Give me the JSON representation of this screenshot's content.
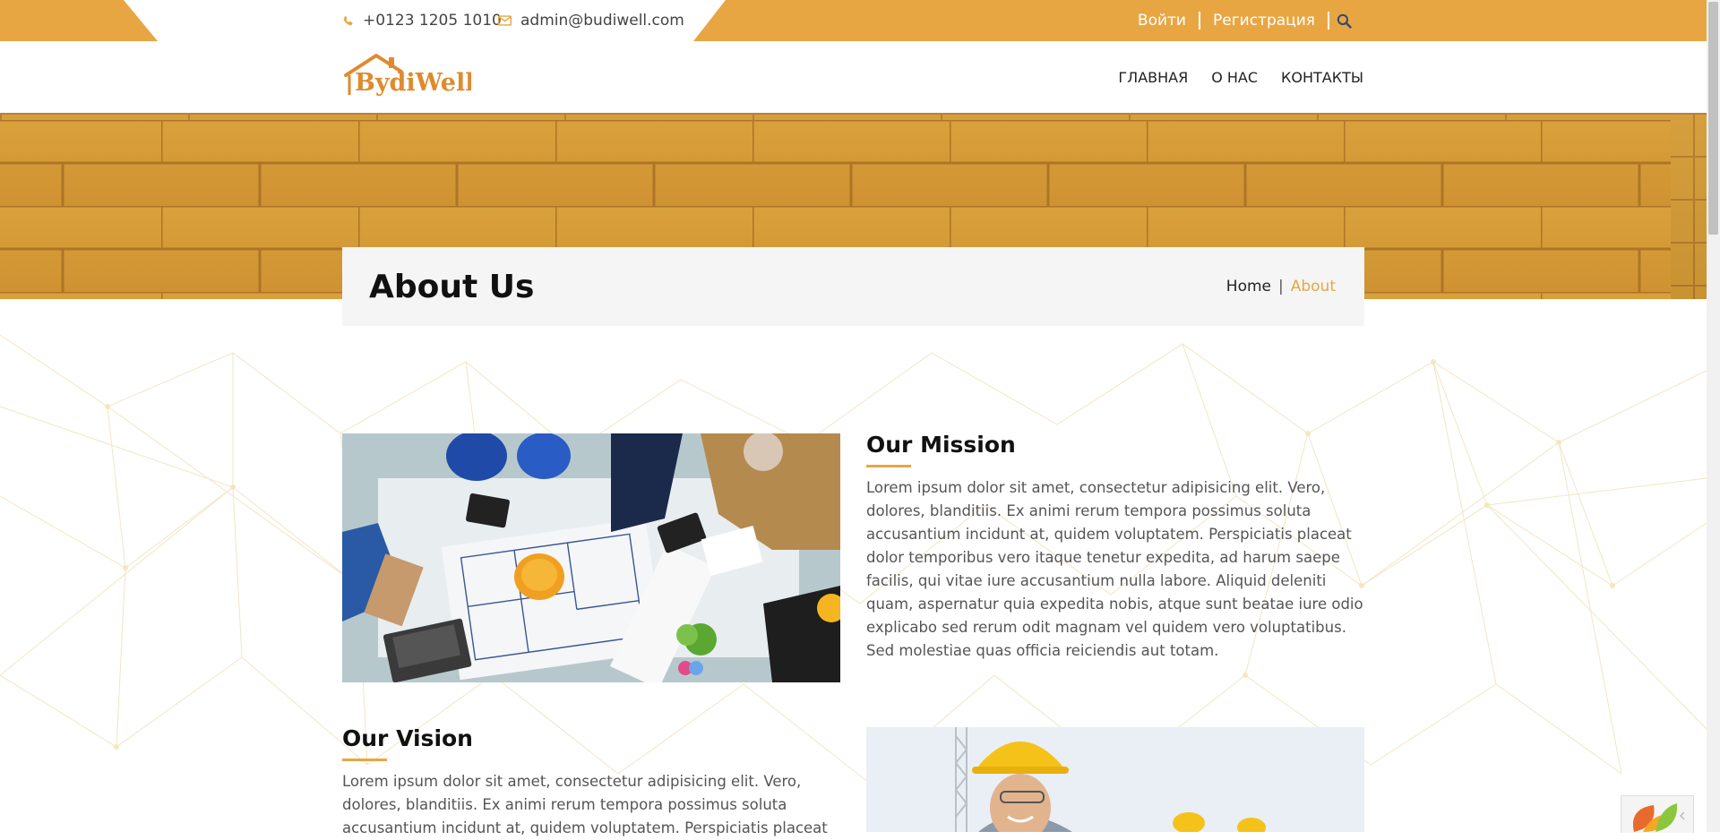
{
  "topbar": {
    "phone": "+0123 1205 1010",
    "email": "admin@budiwell.com",
    "login_label": "Войти",
    "register_label": "Регистрация",
    "accent_color": "#e8a643"
  },
  "header": {
    "logo_text": "BydiWell",
    "nav": [
      "ГЛАВНАЯ",
      "О НАС",
      "КОНТАКТЫ"
    ]
  },
  "page": {
    "title": "About Us",
    "breadcrumb": {
      "home": "Home",
      "current": "About"
    }
  },
  "sections": {
    "mission": {
      "title": "Our Mission",
      "text": "Lorem ipsum dolor sit amet, consectetur adipisicing elit. Vero, dolores, blanditiis. Ex animi rerum tempora possimus soluta accusantium incidunt at, quidem voluptatem. Perspiciatis placeat dolor temporibus vero itaque tenetur expedita, ad harum saepe facilis, qui vitae iure accusantium nulla labore. Aliquid deleniti quam, aspernatur quia expedita nobis, atque sunt beatae iure odio explicabo sed rerum odit magnam vel quidem vero voluptatibus. Sed molestiae quas officia reiciendis aut totam."
    },
    "vision": {
      "title": "Our Vision",
      "text": "Lorem ipsum dolor sit amet, consectetur adipisicing elit. Vero, dolores, blanditiis. Ex animi rerum tempora possimus soluta accusantium incidunt at, quidem voluptatem. Perspiciatis placeat"
    }
  },
  "icons": {
    "phone": "phone-icon",
    "email": "envelope-icon",
    "search": "search-icon",
    "widget": "leaf-widget-icon"
  }
}
